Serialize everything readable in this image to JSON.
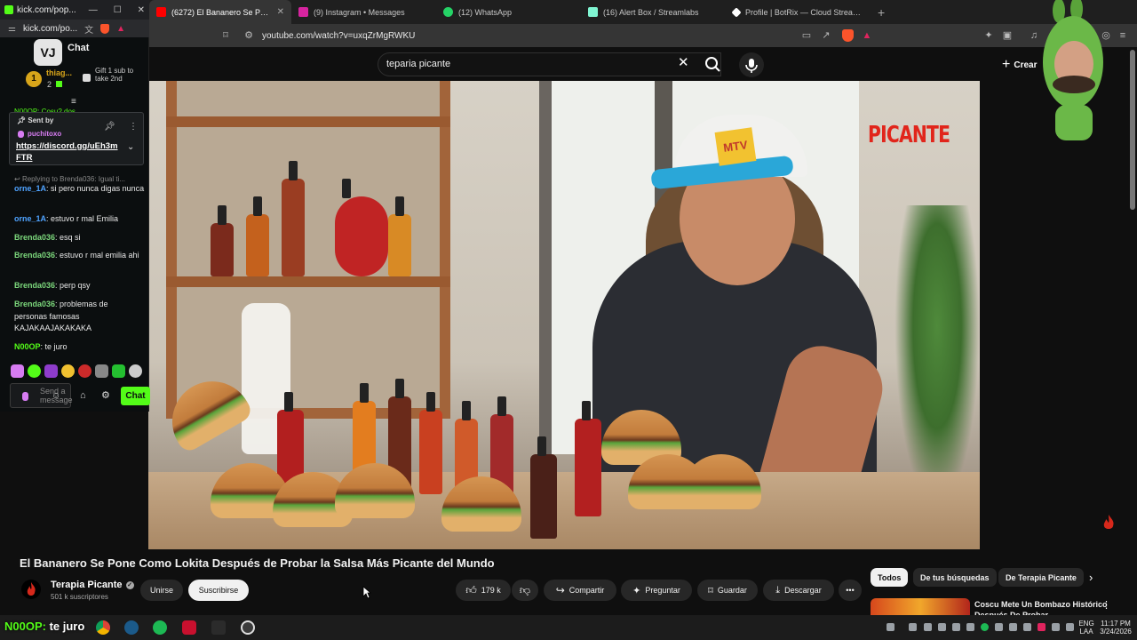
{
  "kick": {
    "window_title": "kick.com/pop...",
    "address": "kick.com/po...",
    "logo_text": "VJ",
    "chat_label": "Chat",
    "gift": {
      "user": "thiag...",
      "count": "2",
      "rank": "1",
      "text": "Gift 1 sub to take 2nd"
    },
    "partial_top": "N00OP: Cosu? dos...",
    "pinned": {
      "label": "Sent by",
      "user": "puchitoxo",
      "link": "https://discord.gg/uEh3mFTR"
    },
    "reply_to": "Replying to Brenda036: Igual ti...",
    "messages": [
      {
        "user": "orne_1A",
        "text": ": si pero nunca digas nunca",
        "color": "#4fa3ff"
      },
      {
        "user": "orne_1A",
        "text": ": estuvo r mal Emilia",
        "color": "#4fa3ff"
      },
      {
        "user": "Brenda036",
        "text": ": esq si",
        "color": "#7cd87c"
      },
      {
        "user": "Brenda036",
        "text": ": estuvo r mal emilia ahi",
        "color": "#7cd87c"
      },
      {
        "user": "Brenda036",
        "text": ": perp qsy",
        "color": "#7cd87c"
      },
      {
        "user": "Brenda036",
        "text": ": problemas de personas famosas KAJAKAAJAKAKAKA",
        "color": "#7cd87c"
      },
      {
        "user": "N00OP",
        "text": ": te juro",
        "color": "#53fc18"
      }
    ],
    "input_placeholder": "Send a message",
    "send_label": "Chat"
  },
  "tabs": [
    {
      "title": "(6272) El Bananero Se Pone C",
      "color": "#ff0000",
      "active": true
    },
    {
      "title": "(9) Instagram • Messages",
      "color": "#d6249f"
    },
    {
      "title": "(12) WhatsApp",
      "color": "#25d366"
    },
    {
      "title": "(16) Alert Box / Streamlabs",
      "color": "#80f5d2"
    },
    {
      "title": "Profile | BotRix — Cloud Streaming B",
      "color": "#ffffff"
    }
  ],
  "browser": {
    "url": "youtube.com/watch?v=uxqZrMgRWKU"
  },
  "youtube": {
    "search_value": "teparia picante",
    "create_label": "Crear",
    "overlay_label": "PICANTE",
    "video_title": "El Bananero Se Pone Como Lokita Después de Probar la Salsa Más Picante del Mundo",
    "channel": {
      "name": "Terapia Picante",
      "subscribers": "501 k suscriptores"
    },
    "join_label": "Unirse",
    "subscribe_label": "Suscribirse",
    "likes": "179 k",
    "share_label": "Compartir",
    "ask_label": "Preguntar",
    "save_label": "Guardar",
    "download_label": "Descargar",
    "chips": [
      "Todos",
      "De tus búsquedas",
      "De Terapia Picante"
    ],
    "recommendation_title": "Coscu Mete Un Bombazo Histórico Después De Probar..."
  },
  "taskbar": {
    "overlay_user": "N00OP:",
    "overlay_text": " te juro",
    "lang": "ENG",
    "layout": "LAA",
    "time": "11:17 PM",
    "date": "3/24/2026"
  }
}
